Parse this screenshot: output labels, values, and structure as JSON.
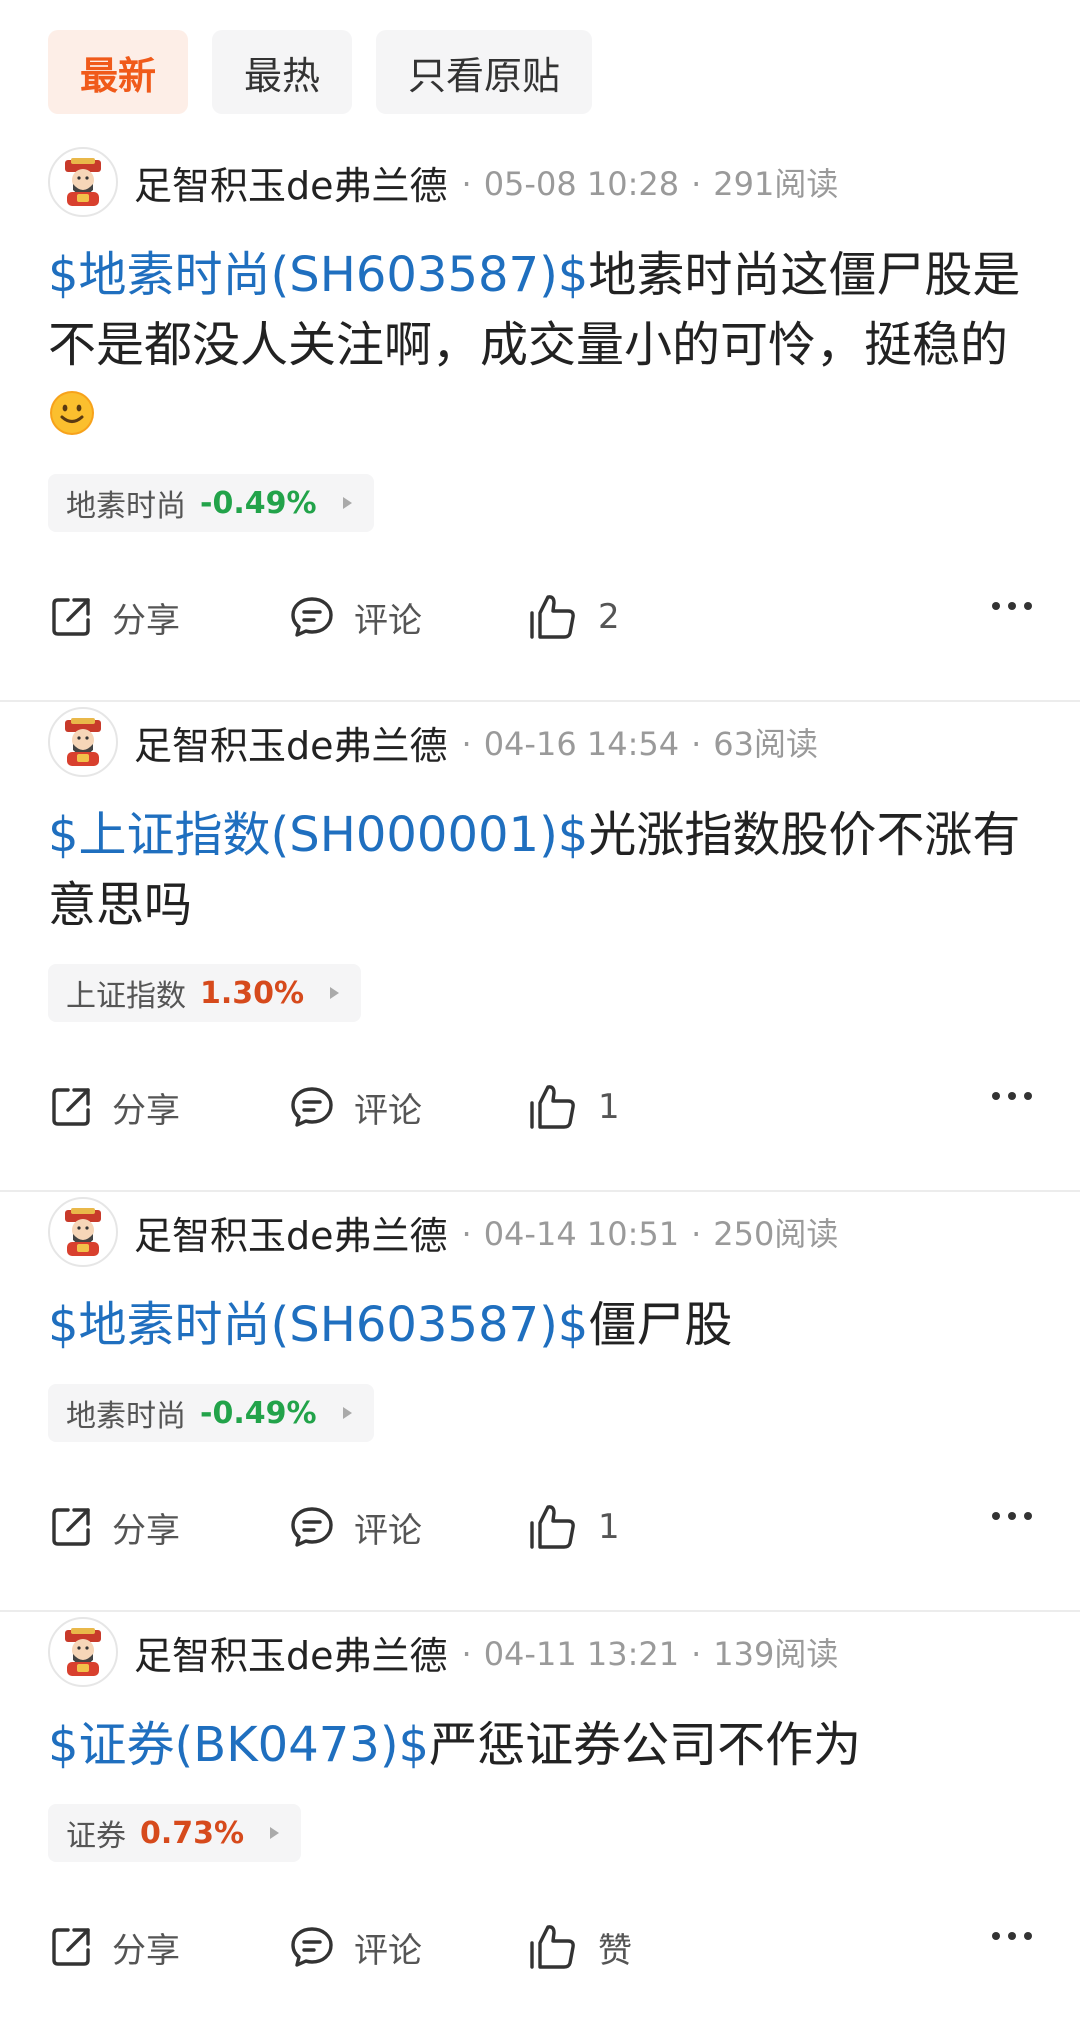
{
  "tabs": [
    {
      "label": "最新",
      "active": true
    },
    {
      "label": "最热",
      "active": false
    },
    {
      "label": "只看原贴",
      "active": false
    }
  ],
  "posts": [
    {
      "author": "足智积玉de弗兰德",
      "date": "05-08 10:28",
      "reads": "291阅读",
      "ticker": "$地素时尚(SH603587)$",
      "text": "地素时尚这僵尸股是不是都没人关注啊，成交量小的可怜，挺稳的",
      "has_emoji": true,
      "stock_name": "地素时尚",
      "stock_change": "-0.49%",
      "stock_dir": "down",
      "share_label": "分享",
      "comment_label": "评论",
      "like_label": "2"
    },
    {
      "author": "足智积玉de弗兰德",
      "date": "04-16 14:54",
      "reads": "63阅读",
      "ticker": "$上证指数(SH000001)$",
      "text": "光涨指数股价不涨有意思吗",
      "has_emoji": false,
      "stock_name": "上证指数",
      "stock_change": "1.30%",
      "stock_dir": "up",
      "share_label": "分享",
      "comment_label": "评论",
      "like_label": "1"
    },
    {
      "author": "足智积玉de弗兰德",
      "date": "04-14 10:51",
      "reads": "250阅读",
      "ticker": "$地素时尚(SH603587)$",
      "text": "僵尸股",
      "has_emoji": false,
      "stock_name": "地素时尚",
      "stock_change": "-0.49%",
      "stock_dir": "down",
      "share_label": "分享",
      "comment_label": "评论",
      "like_label": "1"
    },
    {
      "author": "足智积玉de弗兰德",
      "date": "04-11 13:21",
      "reads": "139阅读",
      "ticker": "$证券(BK0473)$",
      "text": "严惩证券公司不作为",
      "has_emoji": false,
      "stock_name": "证券",
      "stock_change": "0.73%",
      "stock_dir": "up",
      "share_label": "分享",
      "comment_label": "评论",
      "like_label": "赞"
    }
  ],
  "icons": {
    "share": "share-icon",
    "comment": "comment-icon",
    "like": "thumbs-up-icon",
    "more": "more-icon"
  },
  "colors": {
    "accent": "#f05a1a",
    "ticker": "#1f6fbf",
    "down": "#22a34a",
    "up": "#d64a1c"
  }
}
